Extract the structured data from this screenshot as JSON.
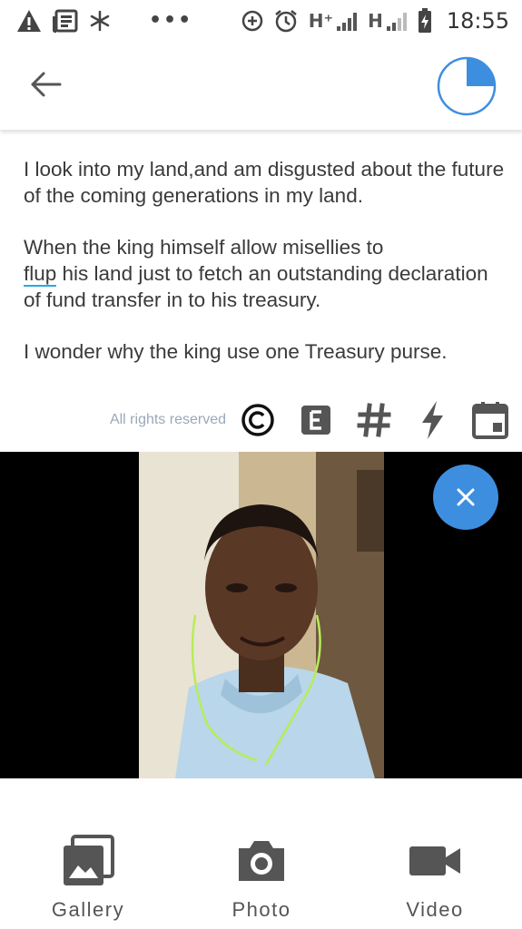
{
  "status_bar": {
    "time": "18:55",
    "network1": "H⁺",
    "network2": "H",
    "icons": [
      "warning-icon",
      "news-icon",
      "snowflake-icon",
      "more-icon",
      "data-saver-icon",
      "alarm-icon",
      "signal-icon",
      "signal-icon",
      "battery-charging-icon"
    ]
  },
  "header": {
    "back_icon": "arrow-left-icon",
    "progress": 0.25,
    "accent_color": "#3e8ee0"
  },
  "post": {
    "paragraphs": [
      "I look into my land,and am disgusted about the future of the coming generations in my land.",
      "When the king himself allow misellies to",
      "I wonder why the king use one Treasury purse."
    ],
    "p2_word": "flup",
    "p2_rest": " his land just to fetch an outstanding declaration of fund transfer in to his treasury."
  },
  "toolbar": {
    "rights_text": "All rights reserved",
    "icons": [
      "copyright-icon",
      "e-format-icon",
      "hashtag-icon",
      "flash-icon",
      "calendar-icon"
    ]
  },
  "media": {
    "close_icon": "close-icon"
  },
  "bottom_bar": {
    "gallery_label": "Gallery",
    "photo_label": "Photo",
    "video_label": "Video"
  }
}
